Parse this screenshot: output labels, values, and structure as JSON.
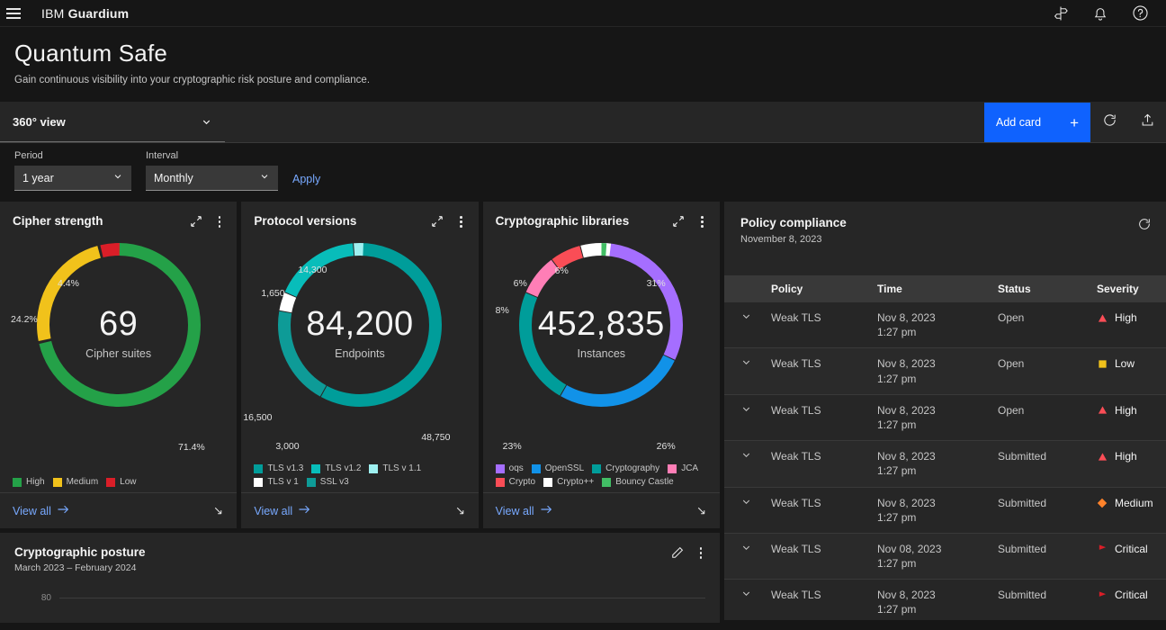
{
  "app": {
    "brand_prefix": "IBM",
    "brand_name": "Guardium",
    "menu_icon": "hamburger-icon",
    "icons": [
      "signpost-icon",
      "bell-icon",
      "help-icon"
    ]
  },
  "page": {
    "title": "Quantum Safe",
    "subtitle": "Gain continuous visibility into your cryptographic risk posture and compliance."
  },
  "viewbar": {
    "view_label": "360° view",
    "add_card_label": "Add card",
    "add_card_plus": "+",
    "refresh_icon": "refresh-icon",
    "export_icon": "export-icon"
  },
  "filters": {
    "period_label": "Period",
    "period_value": "1 year",
    "interval_label": "Interval",
    "interval_value": "Monthly",
    "apply_label": "Apply"
  },
  "cards": {
    "view_all_label": "View all"
  },
  "posture": {
    "title": "Cryptographic posture",
    "subtitle": "March 2023 –  February 2024",
    "axis_top": "80"
  },
  "policy": {
    "title": "Policy compliance",
    "date": "November 8, 2023",
    "columns": [
      "Policy",
      "Time",
      "Status",
      "Severity"
    ],
    "rows": [
      {
        "policy": "Weak TLS",
        "date": "Nov 8, 2023",
        "time": "1:27 pm",
        "status": "Open",
        "severity": "High",
        "sev_color": "#fa4d56",
        "sev_shape": "triangle"
      },
      {
        "policy": "Weak TLS",
        "date": "Nov 8, 2023",
        "time": "1:27 pm",
        "status": "Open",
        "severity": "Low",
        "sev_color": "#f1c21b",
        "sev_shape": "square"
      },
      {
        "policy": "Weak TLS",
        "date": "Nov 8, 2023",
        "time": "1:27 pm",
        "status": "Open",
        "severity": "High",
        "sev_color": "#fa4d56",
        "sev_shape": "triangle"
      },
      {
        "policy": "Weak TLS",
        "date": "Nov 8, 2023",
        "time": "1:27 pm",
        "status": "Submitted",
        "severity": "High",
        "sev_color": "#fa4d56",
        "sev_shape": "triangle"
      },
      {
        "policy": "Weak TLS",
        "date": "Nov 8, 2023",
        "time": "1:27 pm",
        "status": "Submitted",
        "severity": "Medium",
        "sev_color": "#ff832b",
        "sev_shape": "diamond"
      },
      {
        "policy": "Weak TLS",
        "date": "Nov 08, 2023",
        "time": "1:27 pm",
        "status": "Submitted",
        "severity": "Critical",
        "sev_color": "#da1e28",
        "sev_shape": "flag"
      },
      {
        "policy": "Weak TLS",
        "date": "Nov 8, 2023",
        "time": "1:27 pm",
        "status": "Submitted",
        "severity": "Critical",
        "sev_color": "#da1e28",
        "sev_shape": "flag"
      }
    ]
  },
  "chart_data": [
    {
      "type": "pie",
      "title": "Cipher strength",
      "center_value": "69",
      "center_label": "Cipher suites",
      "categories": [
        "High",
        "Medium",
        "Low"
      ],
      "values": [
        71.4,
        24.2,
        4.4
      ],
      "value_labels": [
        "71.4%",
        "24.2%",
        "4.4%"
      ],
      "colors": [
        "#24a148",
        "#f1c21b",
        "#da1e28"
      ],
      "legend": [
        "High",
        "Medium",
        "Low"
      ],
      "legend_position": "bottom",
      "units": "percent"
    },
    {
      "type": "pie",
      "title": "Protocol versions",
      "center_value": "84,200",
      "center_label": "Endpoints",
      "categories": [
        "TLS v1.3",
        "TLS v1.2",
        "TLS v 1.1",
        "TLS v 1",
        "SSL v3"
      ],
      "values": [
        48750,
        14300,
        1650,
        3000,
        16500
      ],
      "value_labels": [
        "48,750",
        "14,300",
        "1,650",
        "3,000",
        "16,500"
      ],
      "colors": [
        "#009d9a",
        "#08bdba",
        "#9ef0f0",
        "#ffffff",
        "#0e9b97"
      ],
      "legend": [
        "TLS v1.3",
        "TLS v1.2",
        "TLS v 1.1",
        "TLS v 1",
        "SSL v3"
      ],
      "legend_position": "bottom",
      "units": "count"
    },
    {
      "type": "pie",
      "title": "Cryptographic libraries",
      "center_value": "452,835",
      "center_label": "Instances",
      "categories": [
        "oqs",
        "OpenSSL",
        "Cryptography",
        "JCA",
        "Crypto",
        "Crypto++",
        "Bouncy Castle"
      ],
      "values": [
        31,
        26,
        23,
        8,
        6,
        6,
        1
      ],
      "value_labels": [
        "31%",
        "26%",
        "23%",
        "8%",
        "6%",
        "6%",
        ""
      ],
      "colors": [
        "#a56eff",
        "#1192e8",
        "#009d9a",
        "#ff7eb6",
        "#fa4d56",
        "#ffffff",
        "#42be65"
      ],
      "legend": [
        "oqs",
        "OpenSSL",
        "Cryptography",
        "JCA",
        "Crypto",
        "Crypto++",
        "Bouncy Castle"
      ],
      "legend_position": "bottom",
      "units": "percent"
    }
  ]
}
